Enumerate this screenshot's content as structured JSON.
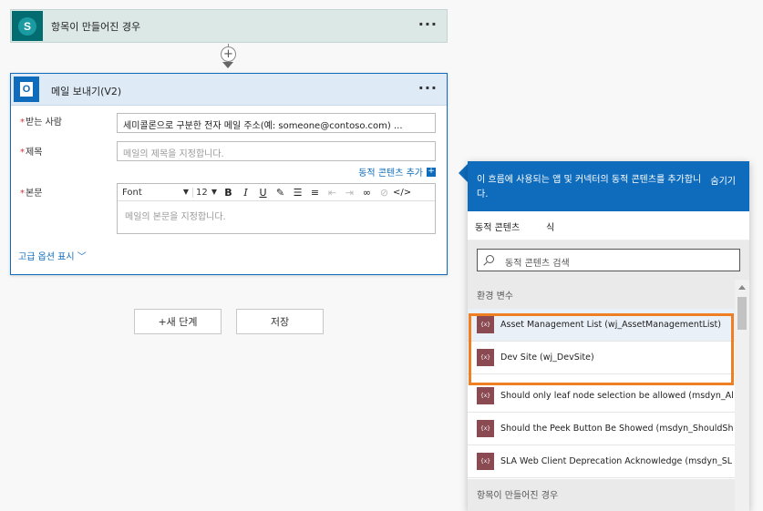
{
  "trigger": {
    "title": "항목이 만들어진 경우",
    "icon_letter": "S",
    "menu": "···"
  },
  "connector": {
    "plus": "+"
  },
  "action": {
    "title": "메일 보내기(V2)",
    "icon_letter": "O",
    "menu": "···",
    "to_label": "받는 사람",
    "to_value": "세미콜론으로 구분한 전자 메일 주소(예: someone@contoso.com) ...",
    "subject_label": "제목",
    "subject_placeholder": "메일의 제목을 지정합니다.",
    "add_dynamic": "동적 콘텐츠 추가",
    "body_label": "본문",
    "font": "Font",
    "font_size": "12",
    "body_placeholder": "메일의 본문을 지정합니다.",
    "advanced": "고급 옵션 표시",
    "required_mark": "*"
  },
  "toolbar_glyphs": {
    "bold": "B",
    "italic": "I",
    "underline": "U",
    "code": "</>",
    "dropdown": "▼"
  },
  "buttons": {
    "new_step": "+새 단계",
    "save": "저장"
  },
  "panel": {
    "description": "이 흐름에 사용되는 앱 및 커넥터의 동적 콘텐츠를 추가합니다.",
    "hide": "숨기기",
    "tab_dynamic": "동적 콘텐츠",
    "tab_expression": "식",
    "search_placeholder": "동적 콘텐츠 검색",
    "section_env": "환경 변수",
    "section_trigger": "항목이 만들어진 경우",
    "item_icon_text": "{x}",
    "items": [
      {
        "label": "Asset Management List (wj_AssetManagementList)"
      },
      {
        "label": "Dev Site (wj_DevSite)"
      },
      {
        "label": "Should only leaf node selection be allowed (msdyn_All..."
      },
      {
        "label": "Should the Peek Button Be Showed (msdyn_ShouldSho..."
      },
      {
        "label": "SLA Web Client Deprecation Acknowledge (msdyn_SL..."
      }
    ]
  },
  "colors": {
    "accent": "#0f6cbd",
    "highlight": "#f07e22",
    "sharepoint": "#036c70",
    "variable_icon": "#8b4a52"
  }
}
